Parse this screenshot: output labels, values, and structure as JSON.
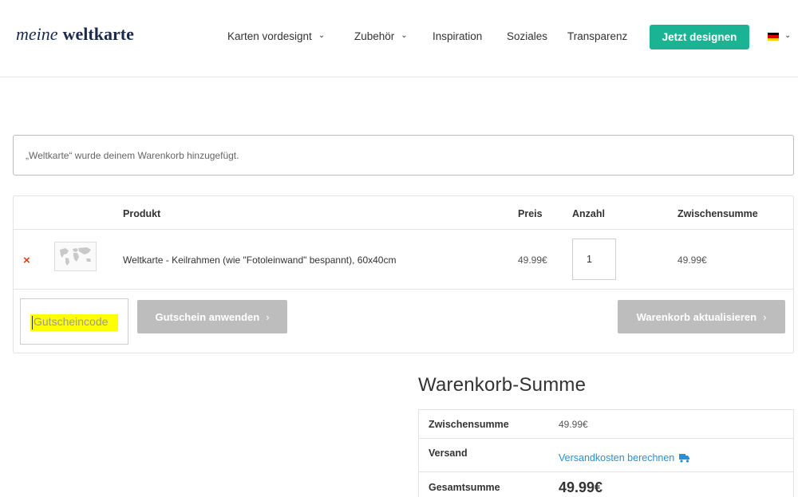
{
  "header": {
    "logo_part1": "meine",
    "logo_part2": "weltkarte",
    "nav": [
      {
        "label": "Karten vordesignt",
        "has_dropdown": true
      },
      {
        "label": "Zubehör",
        "has_dropdown": true
      },
      {
        "label": "Inspiration",
        "has_dropdown": false
      },
      {
        "label": "Soziales",
        "has_dropdown": false
      },
      {
        "label": "Transparenz",
        "has_dropdown": false
      }
    ],
    "cta_label": "Jetzt designen",
    "language_icon": "german-flag-icon"
  },
  "notice": {
    "text": "„Weltkarte“ wurde deinem Warenkorb hinzugefügt."
  },
  "cart": {
    "columns": {
      "product": "Produkt",
      "price": "Preis",
      "quantity": "Anzahl",
      "subtotal": "Zwischensumme"
    },
    "items": [
      {
        "remove_icon": "×",
        "name": "Weltkarte - Keilrahmen (wie \"Fotoleinwand\" bespannt), 60x40cm",
        "price": "49.99€",
        "quantity": "1",
        "subtotal": "49.99€"
      }
    ],
    "coupon_placeholder": "Gutscheincode",
    "apply_coupon_label": "Gutschein anwenden",
    "update_cart_label": "Warenkorb aktualisieren",
    "button_arrow": "›"
  },
  "totals": {
    "title": "Warenkorb-Summe",
    "subtotal_label": "Zwischensumme",
    "subtotal_value": "49.99€",
    "shipping_label": "Versand",
    "shipping_link": "Versandkosten berechnen",
    "total_label": "Gesamtsumme",
    "total_value": "49.99€"
  },
  "colors": {
    "accent": "#1ab394",
    "button_grey": "#bdbdbd",
    "link": "#2a8fd6",
    "remove": "#e2401c",
    "highlight": "#ffff00"
  }
}
